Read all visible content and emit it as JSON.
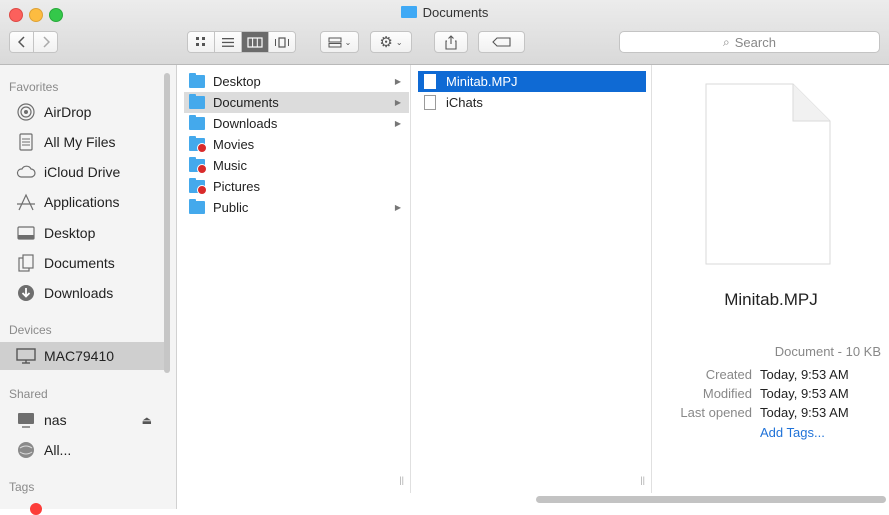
{
  "window": {
    "title": "Documents"
  },
  "toolbar": {
    "search_placeholder": "Search"
  },
  "sidebar": {
    "favorites_label": "Favorites",
    "favorites": [
      {
        "label": "AirDrop",
        "icon": "airdrop-icon"
      },
      {
        "label": "All My Files",
        "icon": "all-files-icon"
      },
      {
        "label": "iCloud Drive",
        "icon": "cloud-icon"
      },
      {
        "label": "Applications",
        "icon": "applications-icon"
      },
      {
        "label": "Desktop",
        "icon": "desktop-icon"
      },
      {
        "label": "Documents",
        "icon": "documents-icon"
      },
      {
        "label": "Downloads",
        "icon": "downloads-icon"
      }
    ],
    "devices_label": "Devices",
    "devices": [
      {
        "label": "MAC79410",
        "icon": "computer-icon",
        "selected": true
      }
    ],
    "shared_label": "Shared",
    "shared": [
      {
        "label": "nas",
        "icon": "server-icon"
      },
      {
        "label": "All...",
        "icon": "network-icon"
      }
    ],
    "tags_label": "Tags"
  },
  "column1": {
    "items": [
      {
        "label": "Desktop",
        "has_children": true,
        "restricted": false
      },
      {
        "label": "Documents",
        "has_children": true,
        "restricted": false,
        "selected": true
      },
      {
        "label": "Downloads",
        "has_children": true,
        "restricted": false
      },
      {
        "label": "Movies",
        "has_children": false,
        "restricted": true
      },
      {
        "label": "Music",
        "has_children": false,
        "restricted": true
      },
      {
        "label": "Pictures",
        "has_children": false,
        "restricted": true
      },
      {
        "label": "Public",
        "has_children": true,
        "restricted": false
      }
    ]
  },
  "column2": {
    "items": [
      {
        "label": "Minitab.MPJ",
        "selected": true
      },
      {
        "label": "iChats",
        "selected": false
      }
    ]
  },
  "preview": {
    "name": "Minitab.MPJ",
    "kind": "Document - 10 KB",
    "created_label": "Created",
    "created": "Today, 9:53 AM",
    "modified_label": "Modified",
    "modified": "Today, 9:53 AM",
    "opened_label": "Last opened",
    "opened": "Today, 9:53 AM",
    "add_tags": "Add Tags..."
  },
  "colors": {
    "selection_blue": "#0f6ad4",
    "folder_blue": "#44a9ec",
    "link_blue": "#1f72d8"
  }
}
